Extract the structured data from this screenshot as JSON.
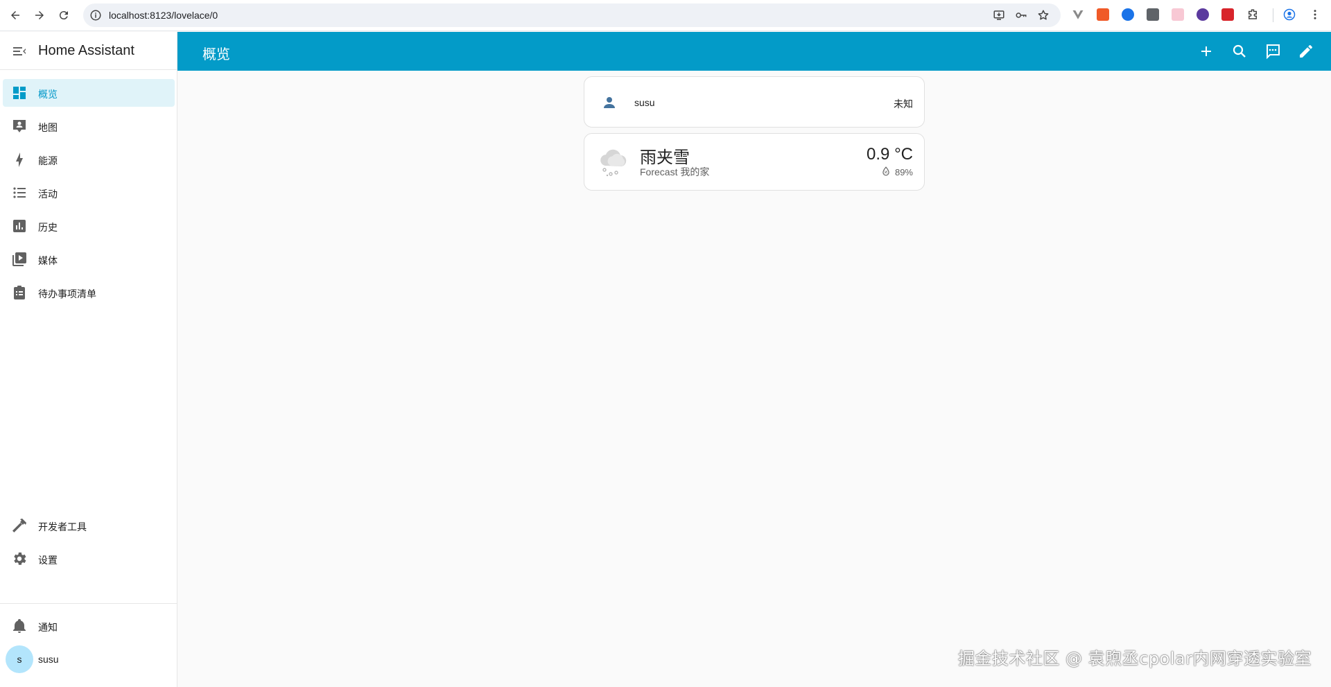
{
  "browser": {
    "url": "localhost:8123/lovelace/0"
  },
  "sidebar": {
    "title": "Home Assistant",
    "items": [
      {
        "label": "概览",
        "icon": "dashboard-icon"
      },
      {
        "label": "地图",
        "icon": "map-account-icon"
      },
      {
        "label": "能源",
        "icon": "lightning-bolt-icon"
      },
      {
        "label": "活动",
        "icon": "format-list-bulleted-icon"
      },
      {
        "label": "历史",
        "icon": "chart-box-icon"
      },
      {
        "label": "媒体",
        "icon": "play-box-multiple-icon"
      },
      {
        "label": "待办事项清单",
        "icon": "clipboard-list-icon"
      }
    ],
    "bottom_items": [
      {
        "label": "开发者工具",
        "icon": "hammer-icon"
      },
      {
        "label": "设置",
        "icon": "cog-icon"
      }
    ],
    "notifications_label": "通知",
    "user": {
      "name": "susu",
      "initial": "s"
    }
  },
  "header": {
    "title": "概览"
  },
  "cards": {
    "entity": {
      "name": "susu",
      "state": "未知"
    },
    "weather": {
      "condition": "雨夹雪",
      "subtitle": "Forecast 我的家",
      "temperature": "0.9 °C",
      "humidity": "89%"
    }
  },
  "watermark": "掘金技术社区 @ 袁煦丞cpolar内网穿透实验室",
  "colors": {
    "accent": "#039bc8",
    "active_bg": "#e0f3f9",
    "icon_gray": "#616161"
  }
}
